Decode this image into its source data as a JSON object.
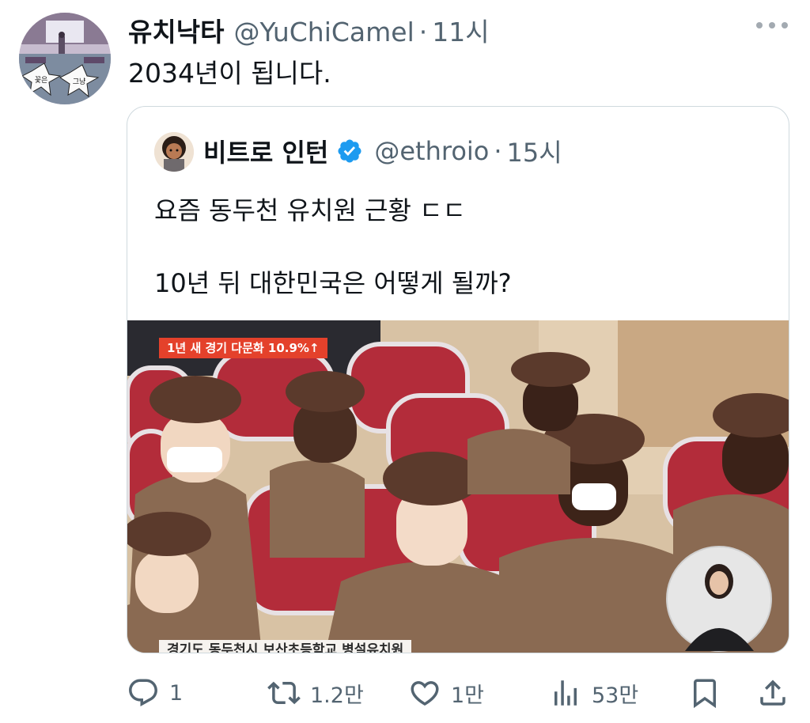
{
  "tweet": {
    "author_name": "유치낙타",
    "author_handle": "@YuChiCamel",
    "separator": "·",
    "time": "11시",
    "text": "2034년이 됩니다.",
    "avatar_text": [
      "꽃은",
      "그냥"
    ]
  },
  "quoted": {
    "author_name": "비트로 인턴",
    "author_handle": "@ethroio",
    "separator": "·",
    "time": "15시",
    "text": "요즘 동두천 유치원 근황 ㄷㄷ\n\n10년 뒤 대한민국은 어떻게 될까?",
    "media": {
      "top_caption": "1년 새 경기 다문화 10.9%↑",
      "bottom_caption": "경기도 동두천시 보산초등학교 병설유치원"
    }
  },
  "actions": {
    "reply_count": "1",
    "retweet_count": "1.2만",
    "like_count": "1만",
    "view_count": "53만"
  },
  "colors": {
    "text_primary": "#0f1419",
    "text_secondary": "#536471",
    "verified_blue": "#1d9bf0",
    "border": "#cfd9de",
    "caption_red": "#e4412b"
  }
}
